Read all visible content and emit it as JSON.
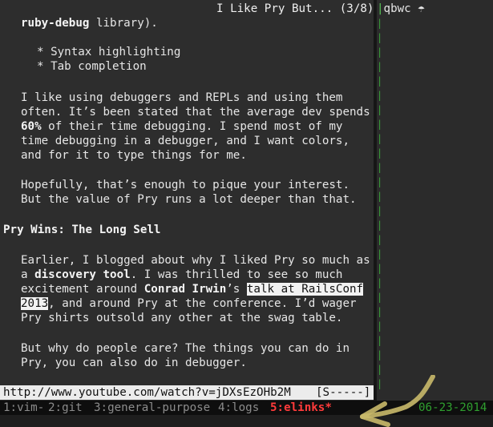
{
  "window": {
    "title": "I Like Pry But... (3/8)",
    "right_title": "qbwc",
    "right_icon": "umbrella-icon"
  },
  "article": {
    "line1_code": "ruby-debug",
    "line1_rest": " library).",
    "bullets": [
      "* Syntax highlighting",
      "* Tab completion"
    ],
    "p1": [
      "I like using debuggers and REPLs and using them",
      "often. It’s been stated that the average dev spends",
      "of their time debugging. I spend most of my",
      "time debugging in a debugger, and I want colors,",
      "and for it to type things for me."
    ],
    "p1_bold": "60%",
    "p2": [
      "Hopefully, that’s enough to pique your interest.",
      "But the value of Pry runs a lot deeper than that."
    ],
    "heading": "Pry Wins: The Long Sell",
    "p3": {
      "l1": "Earlier, I blogged about why I liked Pry so much as",
      "l2_pre": "a ",
      "l2_bold": "discovery tool",
      "l2_post": ". I was thrilled to see so much",
      "l3_pre": "excitement around ",
      "l3_bold": "Conrad Irwin",
      "l3_mid": "’s ",
      "l3_link": "talk at RailsConf",
      "l4_link": "2013",
      "l4_post": ", and around Pry at the conference. I’d wager",
      "l5": "Pry shirts outsold any other at the swag table."
    },
    "p4": [
      "But why do people care? The things you can do in",
      "Pry, you can also do in debugger."
    ]
  },
  "url_bar": {
    "url": "http://www.youtube.com/watch?v=jDXsEzOHb2M",
    "mode": "[S-----]"
  },
  "status": {
    "windows": [
      {
        "label": "1:vim-",
        "active": false
      },
      {
        "label": "2:git",
        "active": false
      },
      {
        "label": "3:general-purpose",
        "active": false
      },
      {
        "label": "4:logs",
        "active": false
      },
      {
        "label": "5:elinks*",
        "active": true
      }
    ],
    "date": "06-23-2014"
  },
  "colors": {
    "background": "#2d2d2d",
    "active_window": "#ff3b3b",
    "date": "#2f9f2f",
    "highlight_arrow": "#c9b96a"
  }
}
